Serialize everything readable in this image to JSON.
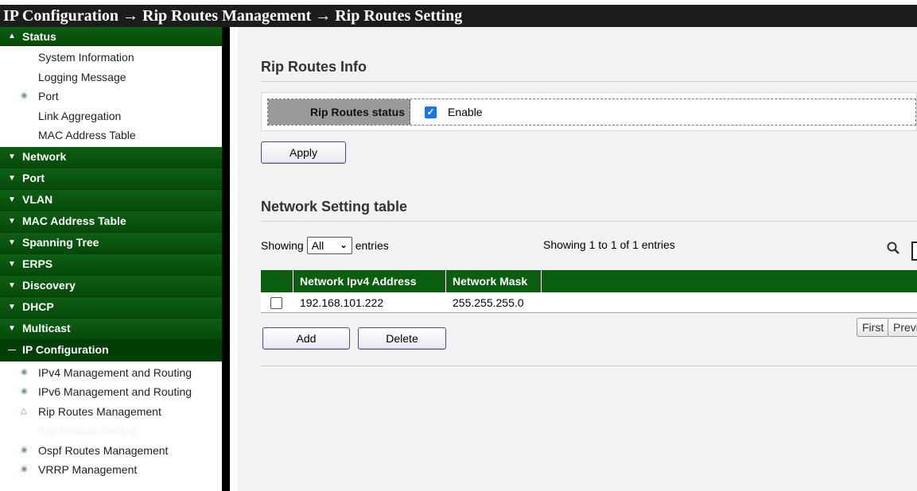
{
  "breadcrumb": {
    "text": "IP Configuration → Rip Routes Management → Rip Routes Setting"
  },
  "sidebar": {
    "status": {
      "label": "Status",
      "items": [
        "System Information",
        "Logging Message",
        "Port",
        "Link Aggregation",
        "MAC Address Table"
      ]
    },
    "sections": [
      {
        "label": "Network"
      },
      {
        "label": "Port"
      },
      {
        "label": "VLAN"
      },
      {
        "label": "MAC Address Table"
      },
      {
        "label": "Spanning Tree"
      },
      {
        "label": "ERPS"
      },
      {
        "label": "Discovery"
      },
      {
        "label": "DHCP"
      },
      {
        "label": "Multicast"
      }
    ],
    "ip_config": {
      "label": "IP Configuration",
      "items": [
        "IPv4 Management and Routing",
        "IPv6 Management and Routing",
        "Rip Routes Management",
        "Rip Routes Setting",
        "Ospf Routes Management",
        "VRRP Management"
      ]
    }
  },
  "rip_info": {
    "title": "Rip Routes Info",
    "status_label": "Rip Routes status",
    "enable_label": "Enable",
    "enabled": true,
    "apply_label": "Apply"
  },
  "network_table": {
    "title": "Network Setting table",
    "showing_prefix": "Showing",
    "page_size": "All",
    "showing_suffix": "entries",
    "info": "Showing 1 to 1 of 1 entries",
    "columns": [
      "Network Ipv4 Address",
      "Network Mask"
    ],
    "rows": [
      {
        "address": "192.168.101.222",
        "mask": "255.255.255.0"
      }
    ],
    "add_label": "Add",
    "delete_label": "Delete",
    "first_label": "First",
    "prev_label": "Previous"
  }
}
